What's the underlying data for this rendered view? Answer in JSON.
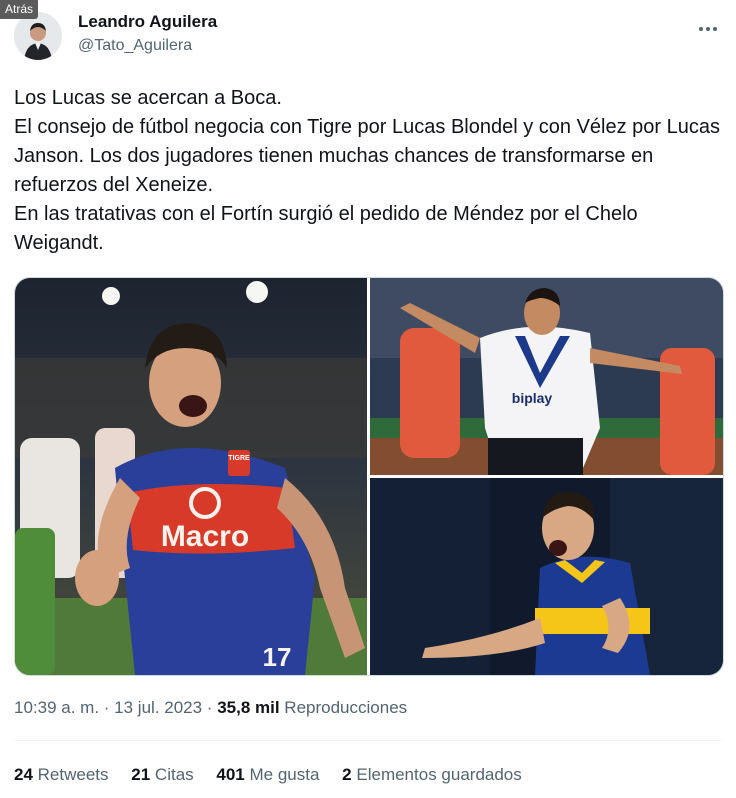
{
  "back_label": "Atrás",
  "author": {
    "display_name": "Leandro Aguilera",
    "handle": "@Tato_Aguilera"
  },
  "tweet": {
    "lines": [
      "Los Lucas se acercan a Boca.",
      "El consejo de fútbol negocia con Tigre por Lucas Blondel y con Vélez por Lucas Janson. Los dos jugadores tienen muchas chances de transformarse en refuerzos del Xeneize.",
      "En las tratativas con el Fortín surgió el pedido de Méndez por el Chelo Weigandt."
    ]
  },
  "media": {
    "photo_left_text": [
      "Macro",
      "TIGRE",
      "17"
    ],
    "photo_tr_text": [
      "biplay"
    ]
  },
  "meta": {
    "time": "10:39 a. m.",
    "sep": " · ",
    "date": "13 jul. 2023",
    "views_count": "35,8 mil",
    "views_label": "Reproducciones"
  },
  "stats": [
    {
      "count": "24",
      "label": "Retweets"
    },
    {
      "count": "21",
      "label": "Citas"
    },
    {
      "count": "401",
      "label": "Me gusta"
    },
    {
      "count": "2",
      "label": "Elementos guardados"
    }
  ],
  "colors": {
    "tigre_blue": "#2a3f9a",
    "tigre_red": "#d83a2a",
    "velez_blue": "#1d3a8a",
    "boca_blue": "#1d3a93",
    "boca_gold": "#f5c518"
  }
}
